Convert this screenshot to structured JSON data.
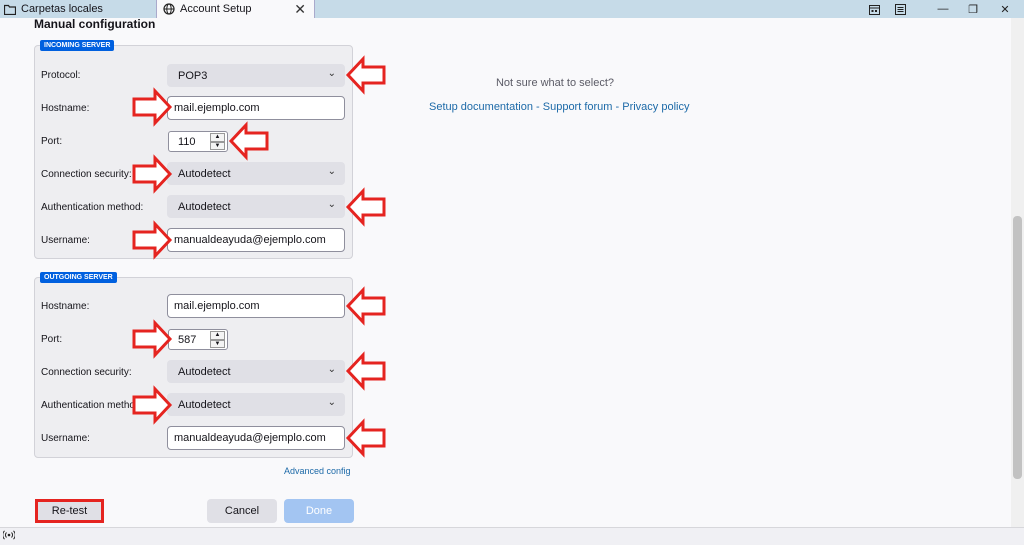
{
  "tabs": [
    {
      "label": "Carpetas locales",
      "icon": "folder-icon"
    },
    {
      "label": "Account Setup",
      "icon": "globe-icon",
      "close": "✕"
    }
  ],
  "window_controls": {
    "minimize": "—",
    "restore": "❐",
    "close": "✕"
  },
  "heading": "Manual configuration",
  "incoming": {
    "legend": "INCOMING SERVER",
    "protocol_label": "Protocol:",
    "protocol_value": "POP3",
    "hostname_label": "Hostname:",
    "hostname_value": "mail.ejemplo.com",
    "port_label": "Port:",
    "port_value": "110",
    "security_label": "Connection security:",
    "security_value": "Autodetect",
    "auth_label": "Authentication method:",
    "auth_value": "Autodetect",
    "username_label": "Username:",
    "username_value": "manualdeayuda@ejemplo.com"
  },
  "outgoing": {
    "legend": "OUTGOING SERVER",
    "hostname_label": "Hostname:",
    "hostname_value": "mail.ejemplo.com",
    "port_label": "Port:",
    "port_value": "587",
    "security_label": "Connection security:",
    "security_value": "Autodetect",
    "auth_label": "Authentication method:",
    "auth_value": "Autodetect",
    "username_label": "Username:",
    "username_value": "manualdeayuda@ejemplo.com"
  },
  "help": {
    "question": "Not sure what to select?",
    "links": [
      "Setup documentation",
      "Support forum",
      "Privacy policy"
    ],
    "separator": " - "
  },
  "advanced_config": "Advanced config",
  "buttons": {
    "retest": "Re-test",
    "cancel": "Cancel",
    "done": "Done"
  },
  "colors": {
    "annotation_red": "#e52420",
    "accent": "#0060df",
    "link": "#1d6aa8"
  }
}
